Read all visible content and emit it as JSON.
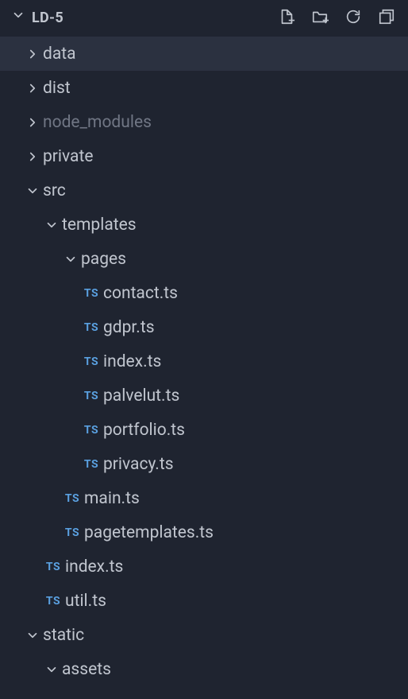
{
  "header": {
    "project_name": "LD-5",
    "actions": {
      "new_file": "New File",
      "new_folder": "New Folder",
      "refresh": "Refresh",
      "collapse_all": "Collapse All"
    }
  },
  "tree": [
    {
      "depth": 0,
      "kind": "folder",
      "expanded": false,
      "label": "data",
      "selected": true,
      "dimmed": false
    },
    {
      "depth": 0,
      "kind": "folder",
      "expanded": false,
      "label": "dist",
      "selected": false,
      "dimmed": false
    },
    {
      "depth": 0,
      "kind": "folder",
      "expanded": false,
      "label": "node_modules",
      "selected": false,
      "dimmed": true
    },
    {
      "depth": 0,
      "kind": "folder",
      "expanded": false,
      "label": "private",
      "selected": false,
      "dimmed": false
    },
    {
      "depth": 0,
      "kind": "folder",
      "expanded": true,
      "label": "src",
      "selected": false,
      "dimmed": false
    },
    {
      "depth": 1,
      "kind": "folder",
      "expanded": true,
      "label": "templates",
      "selected": false,
      "dimmed": false
    },
    {
      "depth": 2,
      "kind": "folder",
      "expanded": true,
      "label": "pages",
      "selected": false,
      "dimmed": false
    },
    {
      "depth": 3,
      "kind": "file-ts",
      "label": "contact.ts",
      "selected": false
    },
    {
      "depth": 3,
      "kind": "file-ts",
      "label": "gdpr.ts",
      "selected": false
    },
    {
      "depth": 3,
      "kind": "file-ts",
      "label": "index.ts",
      "selected": false
    },
    {
      "depth": 3,
      "kind": "file-ts",
      "label": "palvelut.ts",
      "selected": false
    },
    {
      "depth": 3,
      "kind": "file-ts",
      "label": "portfolio.ts",
      "selected": false
    },
    {
      "depth": 3,
      "kind": "file-ts",
      "label": "privacy.ts",
      "selected": false
    },
    {
      "depth": 2,
      "kind": "file-ts",
      "label": "main.ts",
      "selected": false
    },
    {
      "depth": 2,
      "kind": "file-ts",
      "label": "pagetemplates.ts",
      "selected": false
    },
    {
      "depth": 1,
      "kind": "file-ts",
      "label": "index.ts",
      "selected": false
    },
    {
      "depth": 1,
      "kind": "file-ts",
      "label": "util.ts",
      "selected": false
    },
    {
      "depth": 0,
      "kind": "folder",
      "expanded": true,
      "label": "static",
      "selected": false,
      "dimmed": false
    },
    {
      "depth": 1,
      "kind": "folder",
      "expanded": true,
      "label": "assets",
      "selected": false,
      "dimmed": false
    }
  ],
  "file_badge": {
    "ts": "TS"
  }
}
